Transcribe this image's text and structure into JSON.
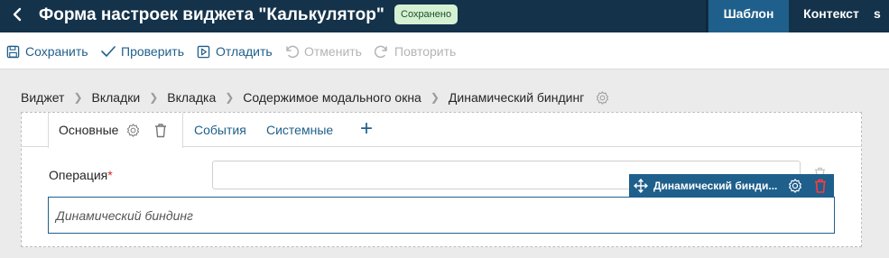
{
  "header": {
    "title": "Форма настроек виджета \"Калькулятор\"",
    "badge": "Сохранено",
    "tabs": [
      {
        "label": "Шаблон",
        "active": true
      },
      {
        "label": "Контекст",
        "active": false
      },
      {
        "label": "s",
        "active": false
      }
    ]
  },
  "toolbar": {
    "save": "Сохранить",
    "check": "Проверить",
    "debug": "Отладить",
    "undo": "Отменить",
    "redo": "Повторить"
  },
  "breadcrumb": [
    "Виджет",
    "Вкладки",
    "Вкладка",
    "Содержимое модального окна",
    "Динамический биндинг"
  ],
  "tabs": {
    "main": "Основные",
    "events": "События",
    "system": "Системные",
    "add": "+"
  },
  "form": {
    "operation_label": "Операция",
    "required_mark": "*",
    "operation_value": "",
    "dynamic_binding_placeholder": "Динамический биндинг"
  },
  "chip": {
    "label": "Динамический бинди..."
  },
  "colors": {
    "header_bg": "#14324a",
    "accent": "#1f5f8b",
    "badge_bg": "#d5f1d3",
    "danger": "#e0242c"
  }
}
